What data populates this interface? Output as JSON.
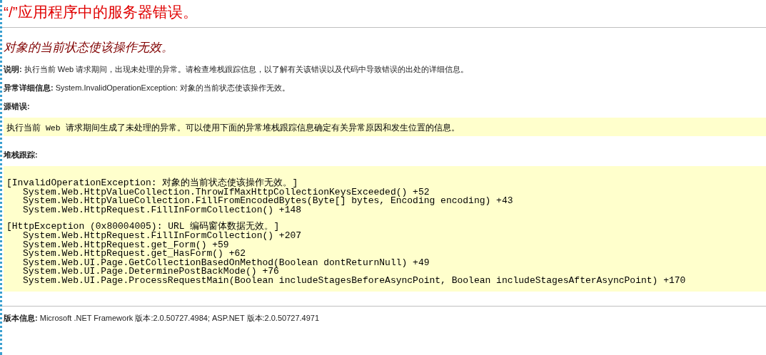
{
  "title": "“/”应用程序中的服务器错误。",
  "message": "对象的当前状态使该操作无效。",
  "description": "**说明:** 执行当前 Web 请求期间，出现未处理的异常。请检查堆栈跟踪信息，以了解有关该错误以及代码中导致错误的出处的详细信息。",
  "exception_details": "**异常详细信息:** System.InvalidOperationException: 对象的当前状态使该操作无效。",
  "source_error": {
    "label": "源错误:",
    "text": "执行当前 Web 请求期间生成了未处理的异常。可以使用下面的异常堆栈跟踪信息确定有关异常原因和发生位置的信息。"
  },
  "stack_trace": {
    "label": "堆栈跟踪:",
    "blocks": [
      {
        "header": "[InvalidOperationException: 对象的当前状态使该操作无效。]",
        "frames": [
          "System.Web.HttpValueCollection.ThrowIfMaxHttpCollectionKeysExceeded() +52",
          "System.Web.HttpValueCollection.FillFromEncodedBytes(Byte[] bytes, Encoding encoding) +43",
          "System.Web.HttpRequest.FillInFormCollection() +148"
        ]
      },
      {
        "header": "[HttpException (0x80004005): URL 编码窗体数据无效。]",
        "frames": [
          "System.Web.HttpRequest.FillInFormCollection() +207",
          "System.Web.HttpRequest.get_Form() +59",
          "System.Web.HttpRequest.get_HasForm() +62",
          "System.Web.UI.Page.GetCollectionBasedOnMethod(Boolean dontReturnNull) +49",
          "System.Web.UI.Page.DeterminePostBackMode() +76",
          "System.Web.UI.Page.ProcessRequestMain(Boolean includeStagesBeforeAsyncPoint, Boolean includeStagesAfterAsyncPoint) +170"
        ]
      }
    ]
  },
  "version": "**版本信息:** Microsoft .NET Framework 版本:2.0.50727.4984; ASP.NET 版本:2.0.50727.4971"
}
